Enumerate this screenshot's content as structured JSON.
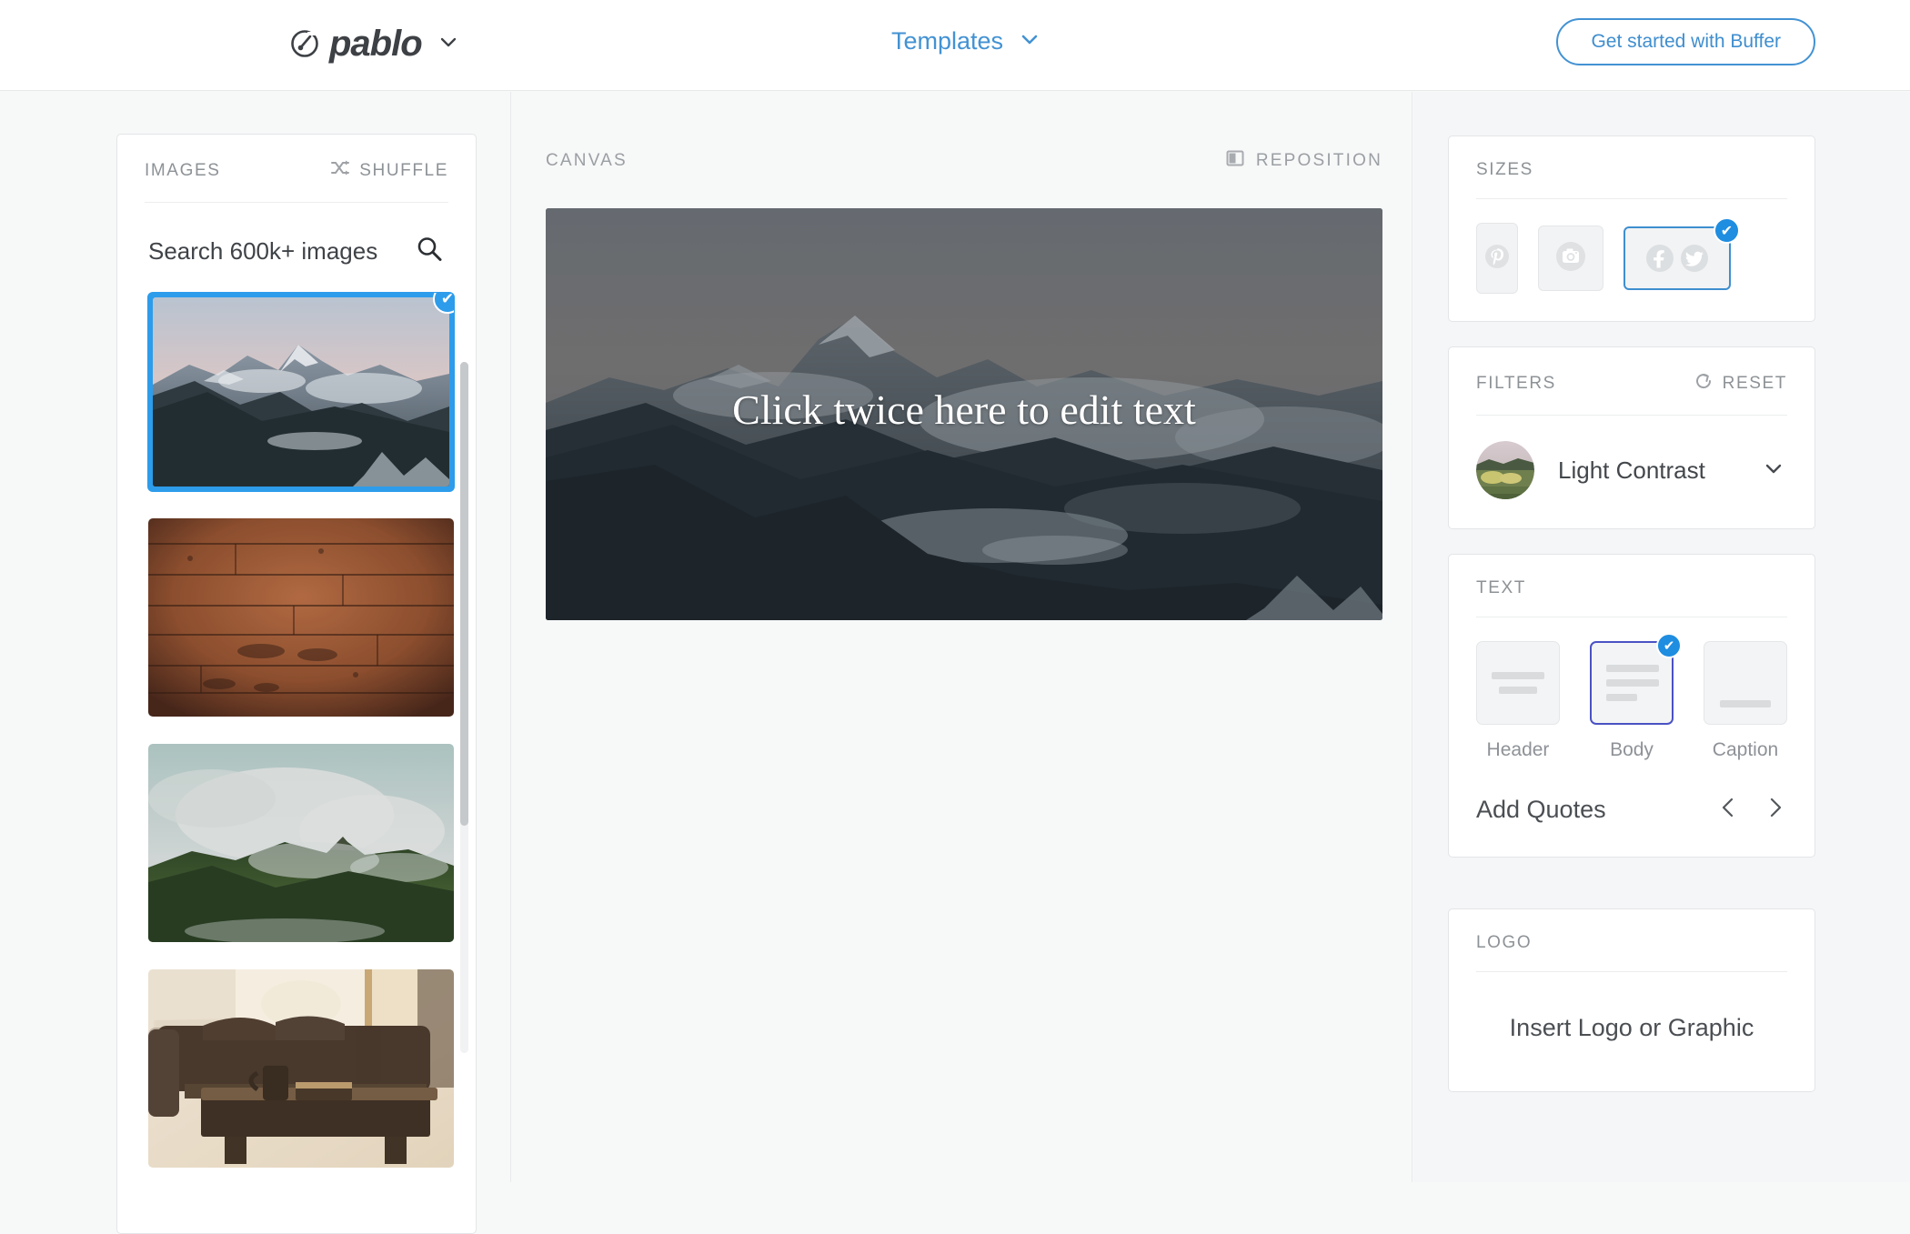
{
  "header": {
    "brand_name": "pablo",
    "brand_icon": "pablo-logo-icon",
    "brand_caret_icon": "chevron-down-icon",
    "nav_templates": "Templates",
    "nav_caret_icon": "chevron-down-icon",
    "cta_label": "Get started with Buffer"
  },
  "images_panel": {
    "title": "IMAGES",
    "shuffle_label": "SHUFFLE",
    "shuffle_icon": "shuffle-icon",
    "search_value": "Search 600k+ images",
    "search_placeholder": "Search 600k+ images",
    "search_icon": "search-icon",
    "thumbnails": [
      {
        "name": "snowy-mountain-dusk",
        "selected": true,
        "check_icon": "check-icon"
      },
      {
        "name": "wooden-planks",
        "selected": false,
        "check_icon": ""
      },
      {
        "name": "cloudy-green-mountain",
        "selected": false,
        "check_icon": ""
      },
      {
        "name": "living-room-sofa",
        "selected": false,
        "check_icon": ""
      }
    ]
  },
  "canvas": {
    "label": "CANVAS",
    "reposition_label": "REPOSITION",
    "reposition_icon": "reposition-icon",
    "text": "Click twice here to edit text",
    "image_name": "snowy-mountain-dusk"
  },
  "sizes": {
    "title": "SIZES",
    "options": [
      {
        "name": "size-pinterest",
        "icon": "pinterest-icon",
        "selected": false
      },
      {
        "name": "size-instagram",
        "icon": "instagram-icon",
        "selected": false
      },
      {
        "name": "size-facebook-twitter",
        "icon": "facebook-twitter-icon",
        "selected": true,
        "check_icon": "check-icon"
      }
    ]
  },
  "filters": {
    "title": "FILTERS",
    "reset_label": "RESET",
    "reset_icon": "reset-icon",
    "selected_filter": "Light Contrast",
    "caret_icon": "chevron-down-icon",
    "preview_name": "filter-preview-thumb"
  },
  "text_section": {
    "title": "TEXT",
    "options": [
      {
        "label": "Header",
        "selected": false
      },
      {
        "label": "Body",
        "selected": true,
        "check_icon": "check-icon"
      },
      {
        "label": "Caption",
        "selected": false
      }
    ],
    "quotes_label": "Add Quotes",
    "prev_icon": "chevron-left-icon",
    "next_icon": "chevron-right-icon"
  },
  "logo_section": {
    "title": "LOGO",
    "insert_label": "Insert Logo or Graphic"
  },
  "colors": {
    "accent_blue": "#2d9ceb",
    "link_blue": "#4392d3",
    "text_selected_border": "#4a52c4",
    "muted_gray": "#8d9296",
    "page_bg": "#f7f8f8"
  }
}
